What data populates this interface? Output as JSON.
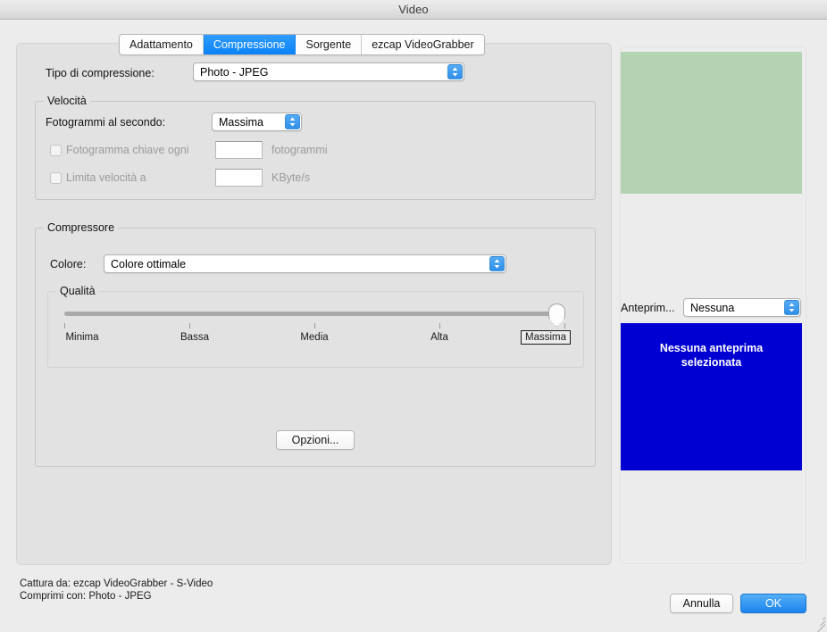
{
  "window": {
    "title": "Video"
  },
  "tabs": [
    {
      "label": "Adattamento",
      "active": false
    },
    {
      "label": "Compressione",
      "active": true
    },
    {
      "label": "Sorgente",
      "active": false
    },
    {
      "label": "ezcap VideoGrabber",
      "active": false
    }
  ],
  "compression": {
    "type_label": "Tipo di compressione:",
    "type_value": "Photo - JPEG"
  },
  "velocita": {
    "group_title": "Velocità",
    "fps_label": "Fotogrammi al secondo:",
    "fps_value": "Massima",
    "keyframe_label": "Fotogramma chiave ogni",
    "keyframe_value": "",
    "keyframe_unit": "fotogrammi",
    "keyframe_checked": false,
    "keyframe_enabled": false,
    "bitrate_label": "Limita velocità a",
    "bitrate_value": "",
    "bitrate_unit": "KByte/s",
    "bitrate_checked": false,
    "bitrate_enabled": false
  },
  "compressore": {
    "group_title": "Compressore",
    "color_label": "Colore:",
    "color_value": "Colore ottimale",
    "quality": {
      "group_title": "Qualità",
      "value": "Massima",
      "position_percent": 100,
      "ticks": [
        "Minima",
        "Bassa",
        "Media",
        "Alta",
        "Massima"
      ]
    },
    "options_button": "Opzioni..."
  },
  "preview": {
    "select_label": "Anteprim...",
    "select_value": "Nessuna",
    "placeholder_text_line1": "Nessuna anteprima",
    "placeholder_text_line2": "selezionata",
    "green_color": "#b4d3b2",
    "blue_color": "#0000d2"
  },
  "footer": {
    "capture_line": "Cattura da: ezcap VideoGrabber - S-Video",
    "compress_line": "Comprimi con: Photo - JPEG",
    "cancel_button": "Annulla",
    "ok_button": "OK"
  },
  "colors": {
    "accent": "#1a8cff",
    "window_bg": "#ececec",
    "panel_bg": "#e2e2e2"
  }
}
